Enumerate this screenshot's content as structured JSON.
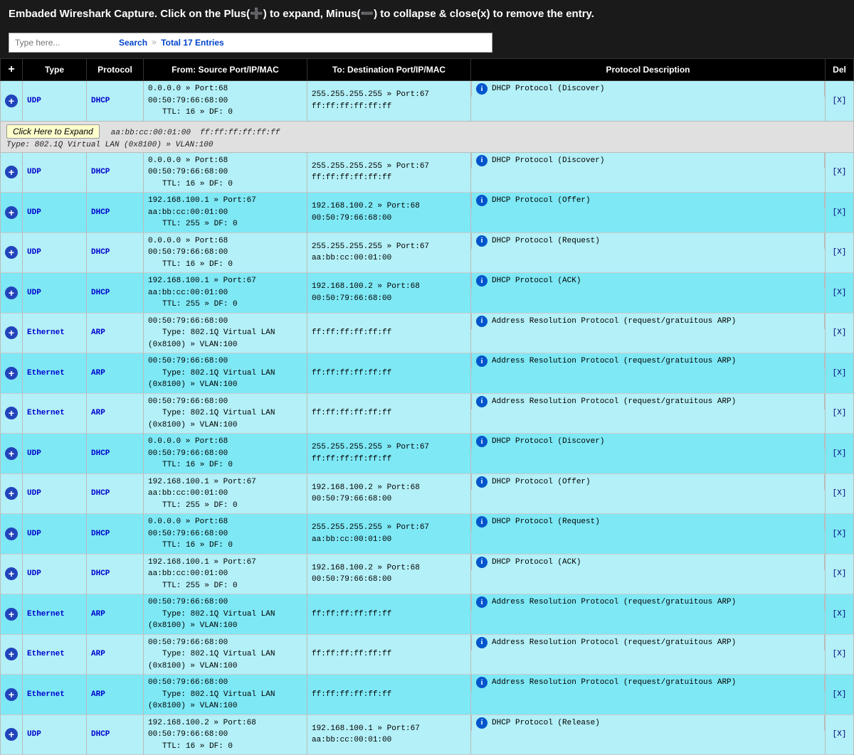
{
  "title": "Embaded Wireshark Capture. Click on the Plus(➕) to expand, Minus(➖) to collapse & close(x) to remove the entry.",
  "search": {
    "placeholder": "Type here...",
    "search_label": "Search",
    "divider": "»",
    "total": "Total 17 Entries"
  },
  "table": {
    "headers": {
      "plus": "+",
      "type": "Type",
      "protocol": "Protocol",
      "from": "From: Source Port/IP/MAC",
      "to": "To: Destination Port/IP/MAC",
      "desc": "Protocol Description",
      "del": "Del"
    }
  },
  "rows": [
    {
      "type": "UDP",
      "protocol": "DHCP",
      "from": "0.0.0.0 » Port:68\n00:50:79:66:68:00",
      "from_sub": "TTL: 16 » DF: 0",
      "to": "255.255.255.255 » Port:67\nff:ff:ff:ff:ff:ff",
      "desc": "DHCP Protocol (Discover)",
      "has_info": true,
      "row_class": "row-light"
    },
    {
      "type": "",
      "protocol": "",
      "from": "aa:bb:cc:00:01:00",
      "from_sub": "Type: 802.1Q Virtual LAN (0x8100) » VLAN:100",
      "to": "ff:ff:ff:ff:ff:ff",
      "desc": "",
      "has_info": false,
      "row_class": "row-tooltip",
      "is_tooltip": true
    },
    {
      "type": "UDP",
      "protocol": "DHCP",
      "from": "0.0.0.0 » Port:68\n00:50:79:66:68:00",
      "from_sub": "TTL: 16 » DF: 0",
      "to": "255.255.255.255 » Port:67\nff:ff:ff:ff:ff:ff",
      "desc": "DHCP Protocol (Discover)",
      "has_info": true,
      "row_class": "row-light"
    },
    {
      "type": "UDP",
      "protocol": "DHCP",
      "from": "192.168.100.1 » Port:67\naa:bb:cc:00:01:00",
      "from_sub": "TTL: 255 » DF: 0",
      "to": "192.168.100.2 » Port:68\n00:50:79:66:68:00",
      "desc": "DHCP Protocol (Offer)",
      "has_info": true,
      "row_class": "row-dark"
    },
    {
      "type": "UDP",
      "protocol": "DHCP",
      "from": "0.0.0.0 » Port:68\n00:50:79:66:68:00",
      "from_sub": "TTL: 16 » DF: 0",
      "to": "255.255.255.255 » Port:67\naa:bb:cc:00:01:00",
      "desc": "DHCP Protocol (Request)",
      "has_info": true,
      "row_class": "row-light"
    },
    {
      "type": "UDP",
      "protocol": "DHCP",
      "from": "192.168.100.1 » Port:67\naa:bb:cc:00:01:00",
      "from_sub": "TTL: 255 » DF: 0",
      "to": "192.168.100.2 » Port:68\n00:50:79:66:68:00",
      "desc": "DHCP Protocol (ACK)",
      "has_info": true,
      "row_class": "row-dark"
    },
    {
      "type": "Ethernet",
      "protocol": "ARP",
      "from": "00:50:79:66:68:00",
      "from_sub": "Type: 802.1Q Virtual LAN (0x8100) » VLAN:100",
      "to": "ff:ff:ff:ff:ff:ff",
      "desc": "Address Resolution Protocol (request/gratuitous ARP)",
      "has_info": true,
      "row_class": "row-light"
    },
    {
      "type": "Ethernet",
      "protocol": "ARP",
      "from": "00:50:79:66:68:00",
      "from_sub": "Type: 802.1Q Virtual LAN (0x8100) » VLAN:100",
      "to": "ff:ff:ff:ff:ff:ff",
      "desc": "Address Resolution Protocol (request/gratuitous ARP)",
      "has_info": true,
      "row_class": "row-dark"
    },
    {
      "type": "Ethernet",
      "protocol": "ARP",
      "from": "00:50:79:66:68:00",
      "from_sub": "Type: 802.1Q Virtual LAN (0x8100) » VLAN:100",
      "to": "ff:ff:ff:ff:ff:ff",
      "desc": "Address Resolution Protocol (request/gratuitous ARP)",
      "has_info": true,
      "row_class": "row-light"
    },
    {
      "type": "UDP",
      "protocol": "DHCP",
      "from": "0.0.0.0 » Port:68\n00:50:79:66:68:00",
      "from_sub": "TTL: 16 » DF: 0",
      "to": "255.255.255.255 » Port:67\nff:ff:ff:ff:ff:ff",
      "desc": "DHCP Protocol (Discover)",
      "has_info": true,
      "row_class": "row-dark"
    },
    {
      "type": "UDP",
      "protocol": "DHCP",
      "from": "192.168.100.1 » Port:67\naa:bb:cc:00:01:00",
      "from_sub": "TTL: 255 » DF: 0",
      "to": "192.168.100.2 » Port:68\n00:50:79:66:68:00",
      "desc": "DHCP Protocol (Offer)",
      "has_info": true,
      "row_class": "row-light"
    },
    {
      "type": "UDP",
      "protocol": "DHCP",
      "from": "0.0.0.0 » Port:68\n00:50:79:66:68:00",
      "from_sub": "TTL: 16 » DF: 0",
      "to": "255.255.255.255 » Port:67\naa:bb:cc:00:01:00",
      "desc": "DHCP Protocol (Request)",
      "has_info": true,
      "row_class": "row-dark"
    },
    {
      "type": "UDP",
      "protocol": "DHCP",
      "from": "192.168.100.1 » Port:67\naa:bb:cc:00:01:00",
      "from_sub": "TTL: 255 » DF: 0",
      "to": "192.168.100.2 » Port:68\n00:50:79:66:68:00",
      "desc": "DHCP Protocol (ACK)",
      "has_info": true,
      "row_class": "row-light"
    },
    {
      "type": "Ethernet",
      "protocol": "ARP",
      "from": "00:50:79:66:68:00",
      "from_sub": "Type: 802.1Q Virtual LAN (0x8100) » VLAN:100",
      "to": "ff:ff:ff:ff:ff:ff",
      "desc": "Address Resolution Protocol (request/gratuitous ARP)",
      "has_info": true,
      "row_class": "row-dark"
    },
    {
      "type": "Ethernet",
      "protocol": "ARP",
      "from": "00:50:79:66:68:00",
      "from_sub": "Type: 802.1Q Virtual LAN (0x8100) » VLAN:100",
      "to": "ff:ff:ff:ff:ff:ff",
      "desc": "Address Resolution Protocol (request/gratuitous ARP)",
      "has_info": true,
      "row_class": "row-light"
    },
    {
      "type": "Ethernet",
      "protocol": "ARP",
      "from": "00:50:79:66:68:00",
      "from_sub": "Type: 802.1Q Virtual LAN (0x8100) » VLAN:100",
      "to": "ff:ff:ff:ff:ff:ff",
      "desc": "Address Resolution Protocol (request/gratuitous ARP)",
      "has_info": true,
      "row_class": "row-dark"
    },
    {
      "type": "UDP",
      "protocol": "DHCP",
      "from": "192.168.100.2 » Port:68\n00:50:79:66:68:00",
      "from_sub": "TTL: 16 » DF: 0",
      "to": "192.168.100.1 » Port:67\naa:bb:cc:00:01:00",
      "desc": "DHCP Protocol (Release)",
      "has_info": true,
      "row_class": "row-light"
    }
  ],
  "tooltip_label": "Click Here to Expand"
}
